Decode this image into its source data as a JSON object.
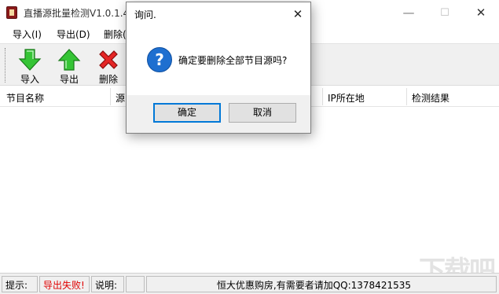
{
  "window": {
    "title": "直播源批量检测V1.0.1.4",
    "controls": {
      "minimize": "—",
      "maximize": "☐",
      "close": "✕"
    }
  },
  "menu": {
    "items": [
      "导入(I)",
      "导出(D)",
      "删除("
    ]
  },
  "toolbar": {
    "buttons": [
      {
        "label": "导入",
        "icon": "import-arrow-down-icon",
        "color": "#2eb82e"
      },
      {
        "label": "导出",
        "icon": "export-arrow-up-icon",
        "color": "#2eb82e"
      },
      {
        "label": "删除",
        "icon": "delete-x-icon",
        "color": "#e02020"
      }
    ]
  },
  "grid": {
    "columns": [
      "节目名称",
      "源",
      "IP所在地",
      "检测结果"
    ]
  },
  "statusbar": {
    "hint_label": "提示:",
    "hint_value": "导出失败!",
    "hint_value_color": "#e00000",
    "desc_label": "说明:",
    "promo": "恒大优惠购房,有需要者请加QQ:1378421535"
  },
  "dialog": {
    "title": "询问.",
    "close": "✕",
    "icon": "question-icon",
    "icon_glyph": "?",
    "message": "确定要删除全部节目源吗?",
    "ok_label": "确定",
    "cancel_label": "取消"
  },
  "colors": {
    "accent": "#0078d7",
    "question_icon": "#1e6fd0"
  }
}
